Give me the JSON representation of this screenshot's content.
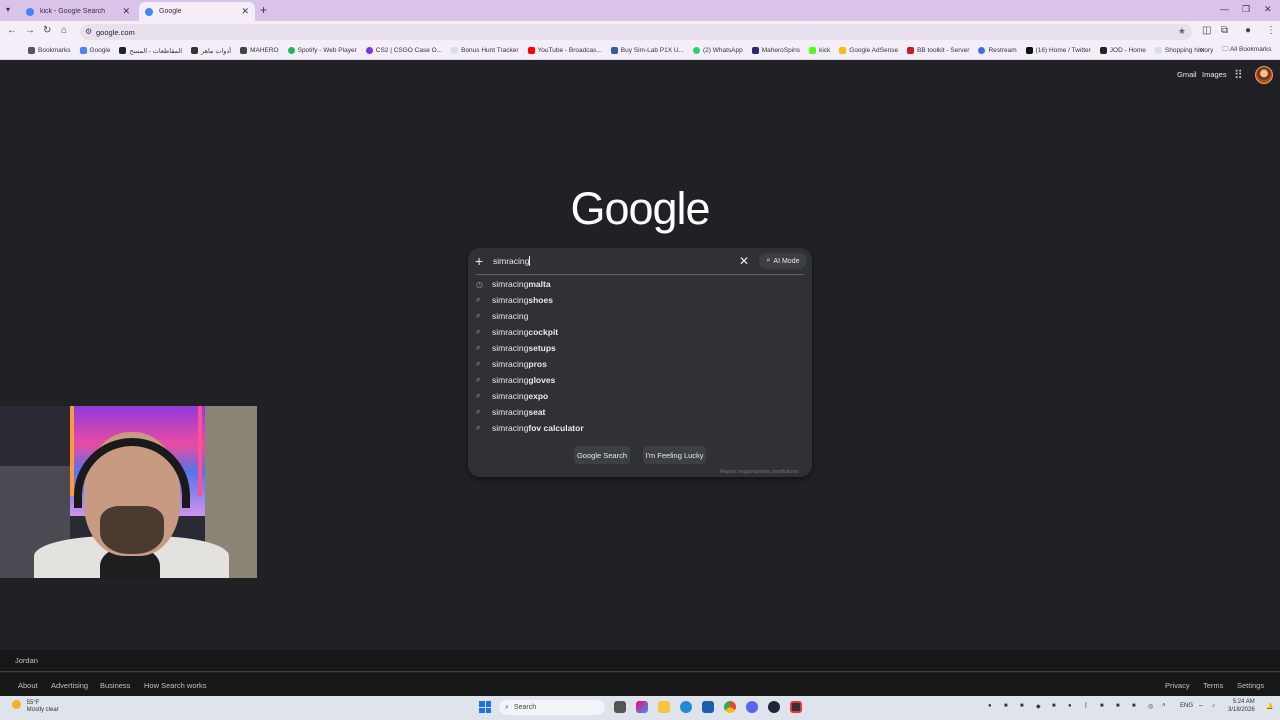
{
  "browser": {
    "tabs": [
      {
        "title": "kick - Google Search",
        "active": false,
        "favicon_color": "#4285f4"
      },
      {
        "title": "Google",
        "active": true,
        "favicon_color": "#4285f4"
      }
    ],
    "new_tab": "+",
    "url": "google.com",
    "bookmarks": [
      {
        "label": "Bookmarks",
        "color": "#555555"
      },
      {
        "label": "Google",
        "color": "#4285f4"
      },
      {
        "label": "المقاطعات - المسح",
        "color": "#222222"
      },
      {
        "label": "أدوات ماهر",
        "color": "#333333"
      },
      {
        "label": "MAHERO",
        "color": "#444444"
      },
      {
        "label": "Spotify - Web Player",
        "color": "#1db954"
      },
      {
        "label": "CS2 | CSGO Case O...",
        "color": "#7b2ff7"
      },
      {
        "label": "Bonus Hunt Tracker",
        "color": "#e0e0e0"
      },
      {
        "label": "YouTube - Broadcas...",
        "color": "#ff0000"
      },
      {
        "label": "Buy Sim-Lab P1X U...",
        "color": "#3a5ba0"
      },
      {
        "label": "(2) WhatsApp",
        "color": "#25d366"
      },
      {
        "label": "MaheroSpins",
        "color": "#2a2a6a"
      },
      {
        "label": "kick",
        "color": "#53fc18"
      },
      {
        "label": "Google AdSense",
        "color": "#fbbc05"
      },
      {
        "label": "BB toolkit - Server",
        "color": "#c0202a"
      },
      {
        "label": "Restream",
        "color": "#3a6ee8"
      },
      {
        "label": "(16) Home / Twitter",
        "color": "#111111"
      },
      {
        "label": "JOD - Home",
        "color": "#222222"
      },
      {
        "label": "Shopping history",
        "color": "#e0e0e0"
      }
    ],
    "all_bookmarks": "All Bookmarks"
  },
  "google": {
    "header_links": [
      "Gmail",
      "Images"
    ],
    "logo": "Google",
    "search_value": "simracing",
    "ai_mode_label": "AI Mode",
    "suggestions": [
      {
        "prefix": "simracing",
        "bold": " malta",
        "icon": "history-icon"
      },
      {
        "prefix": "simracing",
        "bold": " shoes",
        "icon": "search-icon"
      },
      {
        "prefix": "simracing",
        "bold": "",
        "icon": "search-icon"
      },
      {
        "prefix": "simracing",
        "bold": " cockpit",
        "icon": "search-icon"
      },
      {
        "prefix": "simracing",
        "bold": "setups",
        "icon": "search-icon"
      },
      {
        "prefix": "simracing",
        "bold": "pros",
        "icon": "search-icon"
      },
      {
        "prefix": "simracing",
        "bold": " gloves",
        "icon": "search-icon"
      },
      {
        "prefix": "simracing",
        "bold": " expo",
        "icon": "search-icon"
      },
      {
        "prefix": "simracing",
        "bold": " seat",
        "icon": "search-icon"
      },
      {
        "prefix": "simracing",
        "bold": " fov calculator",
        "icon": "search-icon"
      }
    ],
    "google_search_button": "Google Search",
    "lucky_button": "I'm Feeling Lucky",
    "report_link": "Report inappropriate predictions"
  },
  "footer": {
    "location": "Jordan",
    "left_links": [
      "About",
      "Advertising",
      "Business",
      "How Search works"
    ],
    "right_links": [
      "Privacy",
      "Terms",
      "Settings"
    ]
  },
  "taskbar": {
    "weather_temp": "55°F",
    "weather_desc": "Mostly clear",
    "search_label": "Search",
    "language": "ENG",
    "time": "5:24 AM",
    "date": "3/18/2026"
  }
}
